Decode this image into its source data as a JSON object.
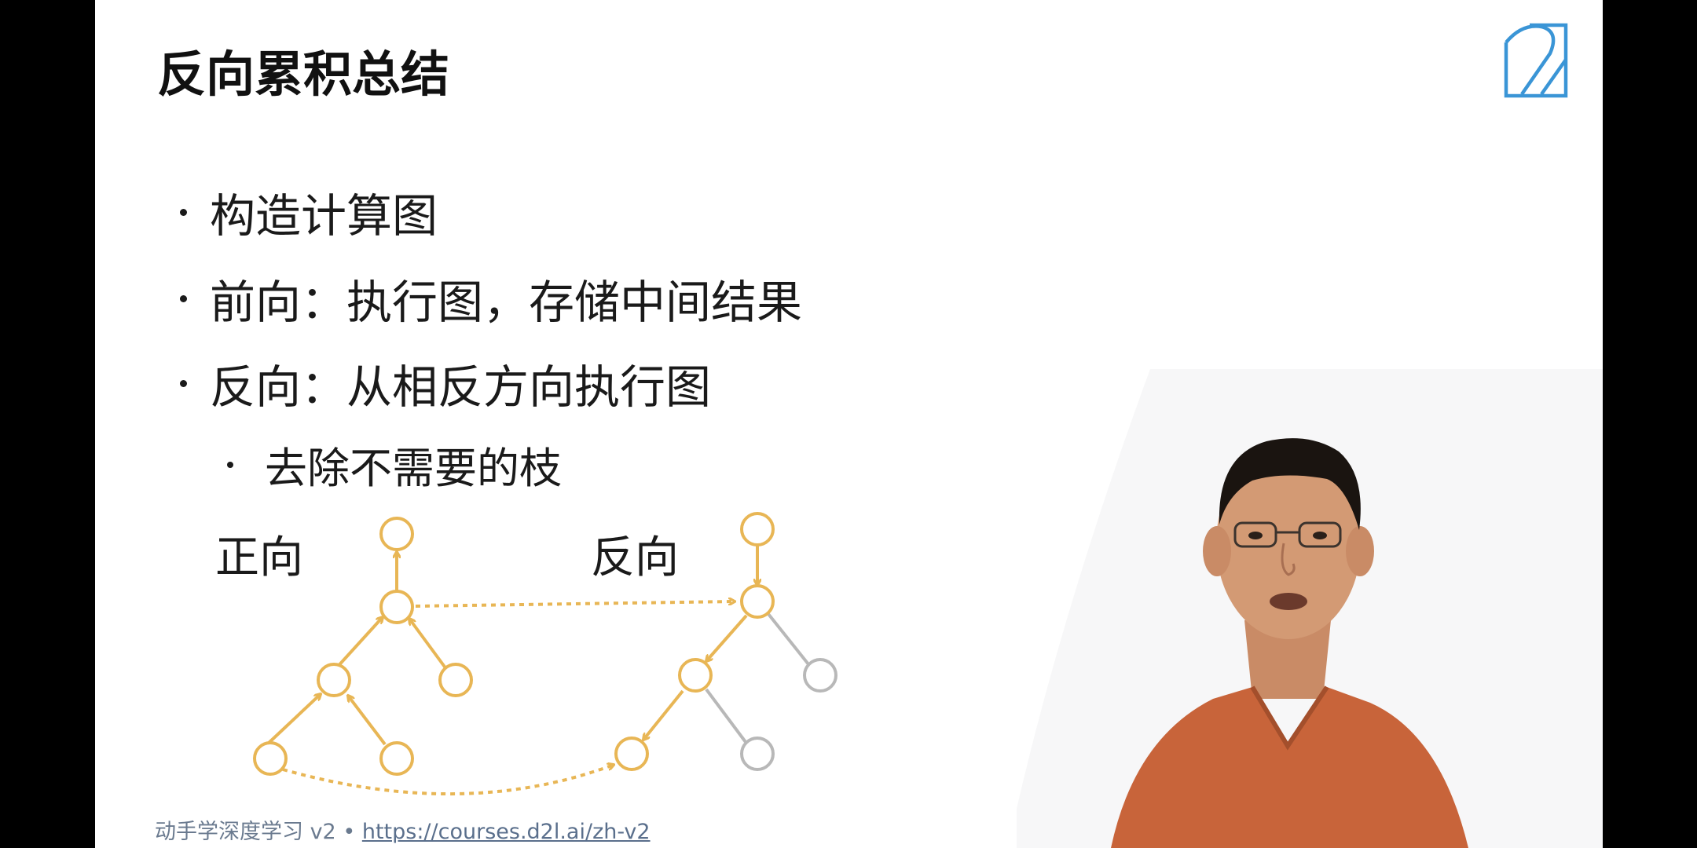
{
  "slide": {
    "title": "反向累积总结",
    "bullets": [
      "构造计算图",
      "前向：执行图，存储中间结果",
      "反向：从相反方向执行图"
    ],
    "sub_bullets": [
      "去除不需要的枝"
    ]
  },
  "diagram": {
    "forward_label": "正向",
    "backward_label": "反向",
    "active_color": "#e8b655",
    "pruned_color": "#b8b8b8"
  },
  "footer": {
    "course_text": "动手学深度学习 v2 • ",
    "link_text": "https://courses.d2l.ai/zh-v2"
  },
  "logo": {
    "icon": "d2l-logo-icon",
    "color": "#3a95d6"
  },
  "presenter": {
    "shirt_color": "#c8643a",
    "background_color": "#ffffff"
  }
}
